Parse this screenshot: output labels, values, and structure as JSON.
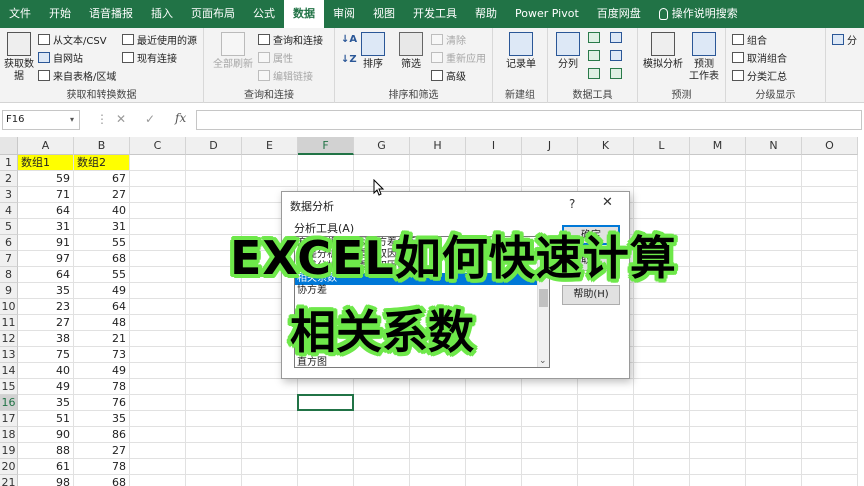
{
  "menu": {
    "tabs": [
      "文件",
      "开始",
      "语音播报",
      "插入",
      "页面布局",
      "公式",
      "数据",
      "审阅",
      "视图",
      "开发工具",
      "帮助",
      "Power Pivot",
      "百度网盘"
    ],
    "active": "数据",
    "tell_me": "操作说明搜索"
  },
  "ribbon": {
    "get_data": {
      "big_label": "获取数\n据",
      "from_text_csv": "从文本/CSV",
      "from_web": "自网站",
      "from_table": "来自表格/区域",
      "recent_sources": "最近使用的源",
      "existing_conn": "现有连接",
      "group_label": "获取和转换数据"
    },
    "queries": {
      "refresh_all": "全部刷新",
      "queries_conn": "查询和连接",
      "properties": "属性",
      "edit_links": "编辑链接",
      "group_label": "查询和连接"
    },
    "sort_filter": {
      "sort": "排序",
      "filter": "筛选",
      "clear": "清除",
      "reapply": "重新应用",
      "advanced": "高级",
      "group_label": "排序和筛选"
    },
    "new_group": {
      "record_form": "记录单",
      "group_label": "新建组"
    },
    "data_tools": {
      "split": "分列",
      "group_label": "数据工具"
    },
    "forecast": {
      "what_if": "模拟分析",
      "forecast_sheet": "预测\n工作表",
      "group_label": "预测"
    },
    "outline": {
      "group": "组合",
      "ungroup": "取消组合",
      "subtotal": "分类汇总",
      "group_label": "分级显示"
    },
    "cut_label": "分"
  },
  "formula_bar": {
    "name_box": "F16",
    "fx": "fx",
    "value": ""
  },
  "sheet": {
    "columns": [
      "A",
      "B",
      "C",
      "D",
      "E",
      "F",
      "G",
      "H",
      "I",
      "J",
      "K",
      "L",
      "M",
      "N",
      "O"
    ],
    "selected_column": "F",
    "selected_row": "16",
    "header_row": [
      "数组1",
      "数组2"
    ],
    "rows": [
      [
        "59",
        "67"
      ],
      [
        "71",
        "27"
      ],
      [
        "64",
        "40"
      ],
      [
        "31",
        "31"
      ],
      [
        "91",
        "55"
      ],
      [
        "97",
        "68"
      ],
      [
        "64",
        "55"
      ],
      [
        "35",
        "49"
      ],
      [
        "23",
        "64"
      ],
      [
        "27",
        "48"
      ],
      [
        "38",
        "21"
      ],
      [
        "75",
        "73"
      ],
      [
        "40",
        "49"
      ],
      [
        "49",
        "78"
      ],
      [
        "35",
        "76"
      ],
      [
        "51",
        "35"
      ],
      [
        "90",
        "86"
      ],
      [
        "88",
        "27"
      ],
      [
        "61",
        "78"
      ],
      [
        "98",
        "68"
      ]
    ]
  },
  "dialog": {
    "title": "数据分析",
    "help_mark": "?",
    "close": "✕",
    "tools_label": "分析工具(A)",
    "list_items": [
      "方差分析：单因素方差分析",
      "方差分析：可重复双因素分析",
      "方差分析：无重复双因素分析",
      "相关系数",
      "协方差",
      "",
      "",
      "",
      "",
      "",
      "直方图"
    ],
    "selected_item": "相关系数",
    "ok_button": "确定",
    "cancel_button": "取消",
    "help_button": "帮助(H)"
  },
  "overlay": {
    "line1": "EXCEL如何快速计算",
    "line2": "相关系数",
    "stroke_color": "#6ee84a"
  },
  "colors": {
    "excel_green": "#217346",
    "header_fill": "#ffff00",
    "selection_blue": "#0078d7"
  }
}
